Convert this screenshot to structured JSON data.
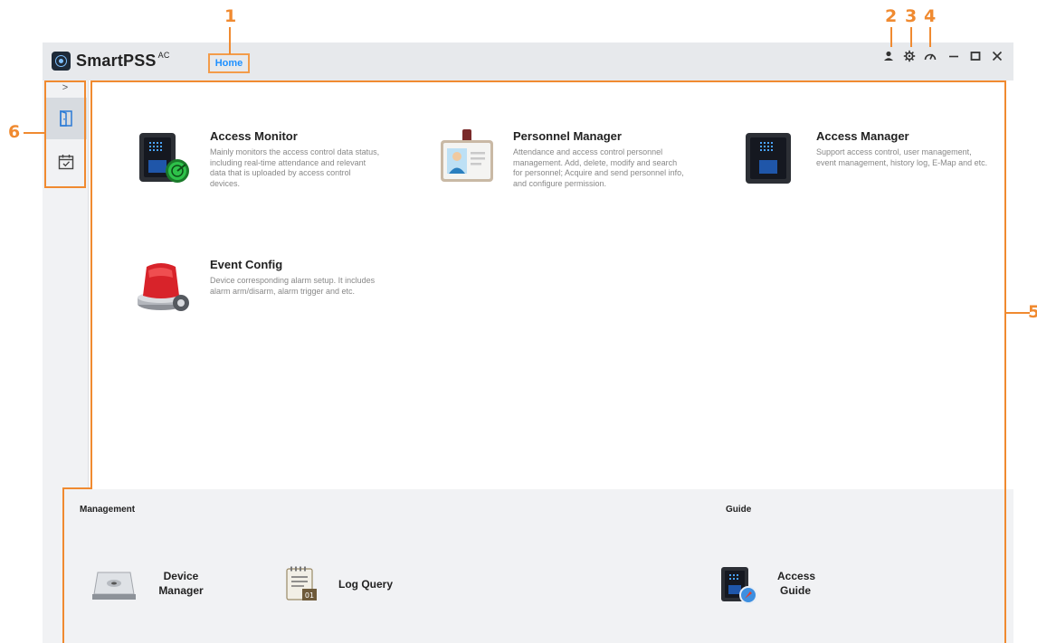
{
  "app": {
    "name": "SmartPSS",
    "name_suffix": "AC"
  },
  "tabs": {
    "home": "Home"
  },
  "titlebar_icons": [
    "user-icon",
    "settings-icon",
    "performance-icon"
  ],
  "window_controls": [
    "minimize-icon",
    "maximize-icon",
    "close-icon"
  ],
  "callouts": {
    "c1": "1",
    "c2": "2",
    "c3": "3",
    "c4": "4",
    "c5": "5",
    "c6": "6"
  },
  "sidebar": {
    "toggle": ">",
    "items": [
      {
        "icon": "door-icon"
      },
      {
        "icon": "calendar-check-icon"
      }
    ]
  },
  "modules": [
    {
      "title": "Access Monitor",
      "desc": "Mainly monitors the access control data status, including real-time attendance and relevant data that is uploaded by access control devices."
    },
    {
      "title": "Personnel Manager",
      "desc": "Attendance and access control personnel management. Add, delete, modify and search for personnel; Acquire and send personnel info, and configure permission."
    },
    {
      "title": "Access Manager",
      "desc": "Support access control, user management, event management, history log, E-Map and etc."
    },
    {
      "title": "Event Config",
      "desc": "Device corresponding alarm setup. It includes alarm arm/disarm, alarm trigger and etc."
    }
  ],
  "bottom": {
    "management_title": "Management",
    "guide_title": "Guide",
    "device_manager": {
      "line1": "Device",
      "line2": "Manager"
    },
    "log_query": "Log Query",
    "access_guide": {
      "line1": "Access",
      "line2": "Guide"
    }
  },
  "colors": {
    "accent": "#f08a30",
    "tab_text": "#1e90ff",
    "panel": "#f1f2f4",
    "titlebar": "#e7e9ec"
  }
}
